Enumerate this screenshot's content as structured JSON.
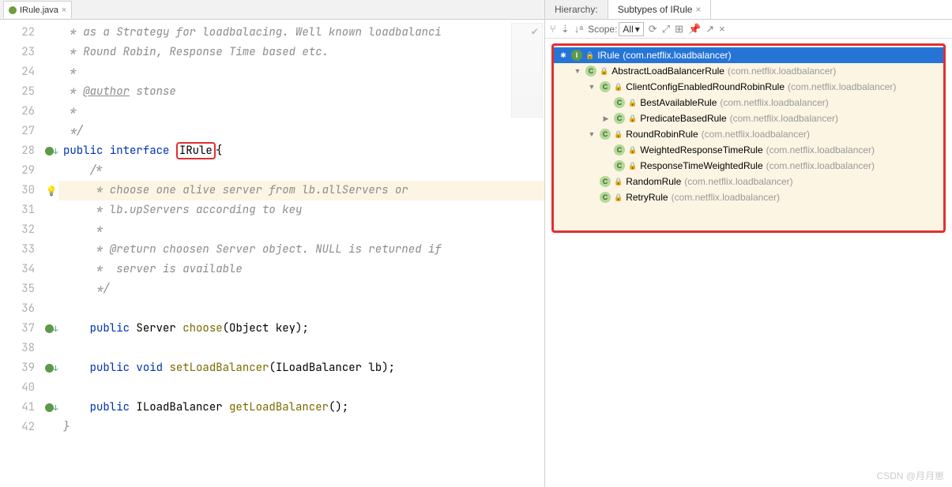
{
  "tab": {
    "filename": "IRule.java"
  },
  "code": {
    "line_numbers": [
      22,
      23,
      24,
      25,
      26,
      27,
      28,
      29,
      30,
      31,
      32,
      33,
      34,
      35,
      36,
      37,
      38,
      39,
      40,
      41,
      42
    ],
    "l22": " * as a Strategy for loadbalacing. Well known loadbalanci",
    "l23": " * Round Robin, Response Time based etc.",
    "l24": " * ",
    "l25a": " * ",
    "l25b": "@author",
    "l25c": " stonse",
    "l26": " *",
    "l27": " */",
    "l28_indent": "   ",
    "l28_kw1": "public",
    "l28_kw2": "interface",
    "l28_name": "IRule",
    "l28_brace": "{",
    "l29": "    /*",
    "l30": "     * choose one alive server from lb.allServers or",
    "l31": "     * lb.upServers according to key",
    "l32": "     * ",
    "l33": "     * @return choosen Server object. NULL is returned if",
    "l34": "     *  server is available",
    "l35": "     */",
    "l37_indent": "    ",
    "l37_kw": "public",
    "l37_ret": "Server",
    "l37_m": "choose",
    "l37_p": "(Object key);",
    "l39_kw1": "public",
    "l39_kw2": "void",
    "l39_m": "setLoadBalancer",
    "l39_p": "(ILoadBalancer lb);",
    "l41_kw": "public",
    "l41_ret": "ILoadBalancer",
    "l41_m": "getLoadBalancer",
    "l41_p": "();",
    "l42": "}"
  },
  "hierarchy": {
    "tab1": "Hierarchy:",
    "tab2": "Subtypes of IRule",
    "scope_label": "Scope:",
    "scope_value": "All",
    "nodes": [
      {
        "name": "IRule",
        "pkg": "(com.netflix.loadbalancer)",
        "kind": "I",
        "depth": 0,
        "selected": true,
        "star": true
      },
      {
        "name": "AbstractLoadBalancerRule",
        "pkg": "(com.netflix.loadbalancer)",
        "kind": "C",
        "depth": 1,
        "twisty": "down"
      },
      {
        "name": "ClientConfigEnabledRoundRobinRule",
        "pkg": "(com.netflix.loadbalancer)",
        "kind": "C",
        "depth": 2,
        "twisty": "down"
      },
      {
        "name": "BestAvailableRule",
        "pkg": "(com.netflix.loadbalancer)",
        "kind": "C",
        "depth": 3
      },
      {
        "name": "PredicateBasedRule",
        "pkg": "(com.netflix.loadbalancer)",
        "kind": "C",
        "depth": 3,
        "twisty": "right"
      },
      {
        "name": "RoundRobinRule",
        "pkg": "(com.netflix.loadbalancer)",
        "kind": "C",
        "depth": 2,
        "twisty": "down"
      },
      {
        "name": "WeightedResponseTimeRule",
        "pkg": "(com.netflix.loadbalancer)",
        "kind": "C",
        "depth": 3
      },
      {
        "name": "ResponseTimeWeightedRule",
        "pkg": "(com.netflix.loadbalancer)",
        "kind": "C",
        "depth": 3
      },
      {
        "name": "RandomRule",
        "pkg": "(com.netflix.loadbalancer)",
        "kind": "C",
        "depth": 2
      },
      {
        "name": "RetryRule",
        "pkg": "(com.netflix.loadbalancer)",
        "kind": "C",
        "depth": 2
      }
    ]
  },
  "watermark": "CSDN @月月崽"
}
